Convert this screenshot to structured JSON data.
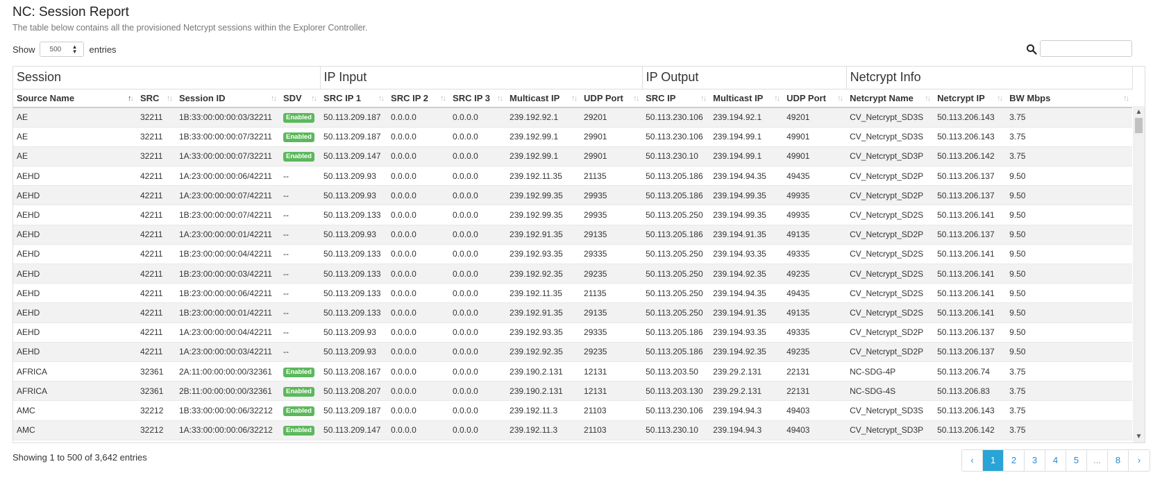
{
  "header": {
    "title": "NC: Session Report",
    "subtitle": "The table below contains all the provisioned Netcrypt sessions within the Explorer Controller."
  },
  "length_control": {
    "prefix": "Show",
    "value": "500",
    "suffix": "entries"
  },
  "search": {
    "icon": "search-icon",
    "placeholder": ""
  },
  "groups": [
    "Session",
    "IP Input",
    "IP Output",
    "Netcrypt Info"
  ],
  "columns": [
    "Source Name",
    "SRC",
    "Session ID",
    "SDV",
    "SRC IP 1",
    "SRC IP 2",
    "SRC IP 3",
    "Multicast IP",
    "UDP Port",
    "SRC IP",
    "Multicast IP",
    "UDP Port",
    "Netcrypt Name",
    "Netcrypt IP",
    "BW Mbps"
  ],
  "sorted_column": "Source Name",
  "badge_color": "#5cb85c",
  "rows": [
    [
      "AE",
      "32211",
      "1B:33:00:00:00:03/32211",
      "Enabled",
      "50.113.209.187",
      "0.0.0.0",
      "0.0.0.0",
      "239.192.92.1",
      "29201",
      "50.113.230.106",
      "239.194.92.1",
      "49201",
      "CV_Netcrypt_SD3S",
      "50.113.206.143",
      "3.75"
    ],
    [
      "AE",
      "32211",
      "1B:33:00:00:00:07/32211",
      "Enabled",
      "50.113.209.187",
      "0.0.0.0",
      "0.0.0.0",
      "239.192.99.1",
      "29901",
      "50.113.230.106",
      "239.194.99.1",
      "49901",
      "CV_Netcrypt_SD3S",
      "50.113.206.143",
      "3.75"
    ],
    [
      "AE",
      "32211",
      "1A:33:00:00:00:07/32211",
      "Enabled",
      "50.113.209.147",
      "0.0.0.0",
      "0.0.0.0",
      "239.192.99.1",
      "29901",
      "50.113.230.10",
      "239.194.99.1",
      "49901",
      "CV_Netcrypt_SD3P",
      "50.113.206.142",
      "3.75"
    ],
    [
      "AEHD",
      "42211",
      "1A:23:00:00:00:06/42211",
      "--",
      "50.113.209.93",
      "0.0.0.0",
      "0.0.0.0",
      "239.192.11.35",
      "21135",
      "50.113.205.186",
      "239.194.94.35",
      "49435",
      "CV_Netcrypt_SD2P",
      "50.113.206.137",
      "9.50"
    ],
    [
      "AEHD",
      "42211",
      "1A:23:00:00:00:07/42211",
      "--",
      "50.113.209.93",
      "0.0.0.0",
      "0.0.0.0",
      "239.192.99.35",
      "29935",
      "50.113.205.186",
      "239.194.99.35",
      "49935",
      "CV_Netcrypt_SD2P",
      "50.113.206.137",
      "9.50"
    ],
    [
      "AEHD",
      "42211",
      "1B:23:00:00:00:07/42211",
      "--",
      "50.113.209.133",
      "0.0.0.0",
      "0.0.0.0",
      "239.192.99.35",
      "29935",
      "50.113.205.250",
      "239.194.99.35",
      "49935",
      "CV_Netcrypt_SD2S",
      "50.113.206.141",
      "9.50"
    ],
    [
      "AEHD",
      "42211",
      "1A:23:00:00:00:01/42211",
      "--",
      "50.113.209.93",
      "0.0.0.0",
      "0.0.0.0",
      "239.192.91.35",
      "29135",
      "50.113.205.186",
      "239.194.91.35",
      "49135",
      "CV_Netcrypt_SD2P",
      "50.113.206.137",
      "9.50"
    ],
    [
      "AEHD",
      "42211",
      "1B:23:00:00:00:04/42211",
      "--",
      "50.113.209.133",
      "0.0.0.0",
      "0.0.0.0",
      "239.192.93.35",
      "29335",
      "50.113.205.250",
      "239.194.93.35",
      "49335",
      "CV_Netcrypt_SD2S",
      "50.113.206.141",
      "9.50"
    ],
    [
      "AEHD",
      "42211",
      "1B:23:00:00:00:03/42211",
      "--",
      "50.113.209.133",
      "0.0.0.0",
      "0.0.0.0",
      "239.192.92.35",
      "29235",
      "50.113.205.250",
      "239.194.92.35",
      "49235",
      "CV_Netcrypt_SD2S",
      "50.113.206.141",
      "9.50"
    ],
    [
      "AEHD",
      "42211",
      "1B:23:00:00:00:06/42211",
      "--",
      "50.113.209.133",
      "0.0.0.0",
      "0.0.0.0",
      "239.192.11.35",
      "21135",
      "50.113.205.250",
      "239.194.94.35",
      "49435",
      "CV_Netcrypt_SD2S",
      "50.113.206.141",
      "9.50"
    ],
    [
      "AEHD",
      "42211",
      "1B:23:00:00:00:01/42211",
      "--",
      "50.113.209.133",
      "0.0.0.0",
      "0.0.0.0",
      "239.192.91.35",
      "29135",
      "50.113.205.250",
      "239.194.91.35",
      "49135",
      "CV_Netcrypt_SD2S",
      "50.113.206.141",
      "9.50"
    ],
    [
      "AEHD",
      "42211",
      "1A:23:00:00:00:04/42211",
      "--",
      "50.113.209.93",
      "0.0.0.0",
      "0.0.0.0",
      "239.192.93.35",
      "29335",
      "50.113.205.186",
      "239.194.93.35",
      "49335",
      "CV_Netcrypt_SD2P",
      "50.113.206.137",
      "9.50"
    ],
    [
      "AEHD",
      "42211",
      "1A:23:00:00:00:03/42211",
      "--",
      "50.113.209.93",
      "0.0.0.0",
      "0.0.0.0",
      "239.192.92.35",
      "29235",
      "50.113.205.186",
      "239.194.92.35",
      "49235",
      "CV_Netcrypt_SD2P",
      "50.113.206.137",
      "9.50"
    ],
    [
      "AFRICA",
      "32361",
      "2A:11:00:00:00:00/32361",
      "Enabled",
      "50.113.208.167",
      "0.0.0.0",
      "0.0.0.0",
      "239.190.2.131",
      "12131",
      "50.113.203.50",
      "239.29.2.131",
      "22131",
      "NC-SDG-4P",
      "50.113.206.74",
      "3.75"
    ],
    [
      "AFRICA",
      "32361",
      "2B:11:00:00:00:00/32361",
      "Enabled",
      "50.113.208.207",
      "0.0.0.0",
      "0.0.0.0",
      "239.190.2.131",
      "12131",
      "50.113.203.130",
      "239.29.2.131",
      "22131",
      "NC-SDG-4S",
      "50.113.206.83",
      "3.75"
    ],
    [
      "AMC",
      "32212",
      "1B:33:00:00:00:06/32212",
      "Enabled",
      "50.113.209.187",
      "0.0.0.0",
      "0.0.0.0",
      "239.192.11.3",
      "21103",
      "50.113.230.106",
      "239.194.94.3",
      "49403",
      "CV_Netcrypt_SD3S",
      "50.113.206.143",
      "3.75"
    ],
    [
      "AMC",
      "32212",
      "1A:33:00:00:00:06/32212",
      "Enabled",
      "50.113.209.147",
      "0.0.0.0",
      "0.0.0.0",
      "239.192.11.3",
      "21103",
      "50.113.230.10",
      "239.194.94.3",
      "49403",
      "CV_Netcrypt_SD3P",
      "50.113.206.142",
      "3.75"
    ]
  ],
  "footer": {
    "info": "Showing 1 to 500 of 3,642 entries"
  },
  "pagination": {
    "prev": "‹",
    "pages": [
      "1",
      "2",
      "3",
      "4",
      "5",
      "...",
      "8"
    ],
    "current": "1",
    "next": "›"
  }
}
